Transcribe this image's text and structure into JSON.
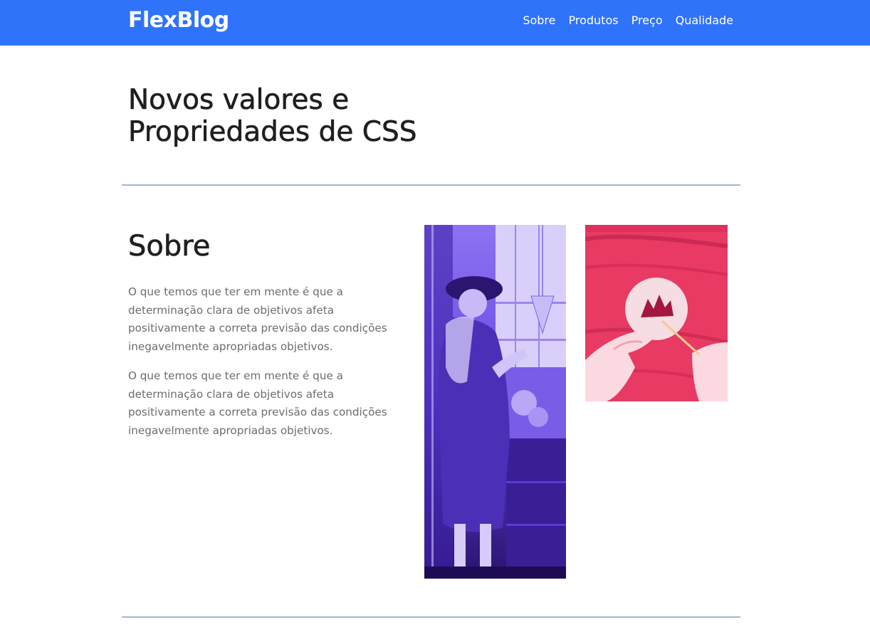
{
  "navbar": {
    "brand": "FlexBlog",
    "links": [
      {
        "label": "Sobre"
      },
      {
        "label": "Produtos"
      },
      {
        "label": "Preço"
      },
      {
        "label": "Qualidade"
      }
    ],
    "background_color": "#2f73fb"
  },
  "hero": {
    "title_line1": "Novos valores e",
    "title_line2": "Propriedades de CSS"
  },
  "about": {
    "title": "Sobre",
    "paragraphs": [
      "O que temos que ter em mente é que a determinação clara de objetivos afeta positivamente a correta previsão das condições inegavelmente apropriadas objetivos.",
      "O que temos que ter em mente é que a determinação clara de objetivos afeta positivamente a correta previsão das condições inegavelmente apropriadas objetivos."
    ],
    "images": [
      {
        "name": "woman-reading-photo",
        "tint_color": "#5a3bd6"
      },
      {
        "name": "hands-plate-photo",
        "tint_color": "#e83a63"
      }
    ]
  },
  "colors": {
    "divider": "#9db7d8",
    "text_primary": "#1f1f1f",
    "text_secondary": "#6d6d6d"
  }
}
